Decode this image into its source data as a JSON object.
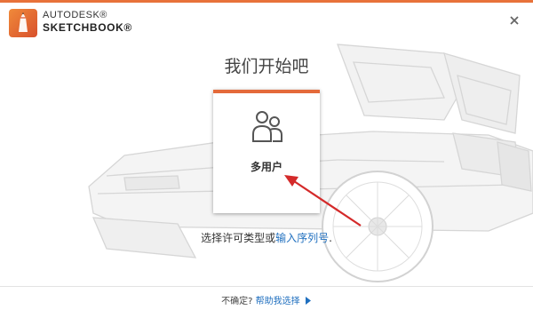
{
  "app": {
    "brand_top": "AUTODESK®",
    "brand_bottom": "SKETCHBOOK®",
    "accent_color": "#e8723a"
  },
  "main": {
    "title": "我们开始吧",
    "card": {
      "label": "多用户",
      "icon": "users-icon"
    },
    "license": {
      "prefix": "选择许可类型或",
      "link": "输入序列号",
      "suffix": "."
    }
  },
  "footer": {
    "question": "不确定?",
    "help_link": "帮助我选择",
    "help_icon": "play-icon",
    "link_color": "#1f6fbf"
  },
  "icons": {
    "close": "close-icon",
    "logo": "sketchbook-logo-icon",
    "arrow": "red-pointer-arrow"
  }
}
